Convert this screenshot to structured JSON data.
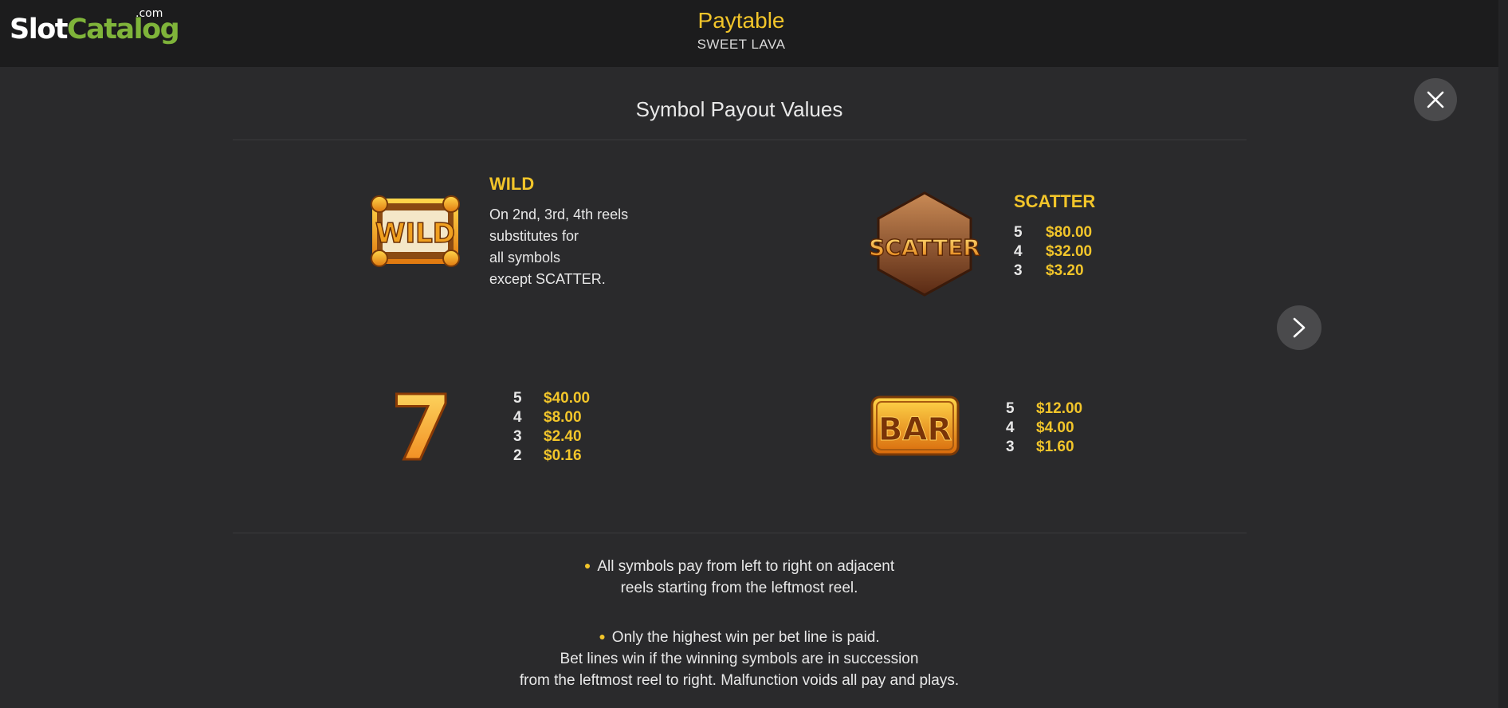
{
  "header": {
    "logo": {
      "slot": "Slot",
      "catalog": "Catalog",
      "dotcom": ".com"
    },
    "title": "Paytable",
    "subtitle": "SWEET LAVA"
  },
  "section_title": "Symbol Payout Values",
  "symbols": [
    {
      "name": "WILD",
      "icon_text": "WILD",
      "description": [
        "On 2nd, 3rd, 4th reels",
        "substitutes for",
        "all symbols",
        "except SCATTER."
      ]
    },
    {
      "name": "SCATTER",
      "icon_text": "SCATTER",
      "pays": [
        {
          "count": "5",
          "amount": "$80.00"
        },
        {
          "count": "4",
          "amount": "$32.00"
        },
        {
          "count": "3",
          "amount": "$3.20"
        }
      ]
    },
    {
      "name": "",
      "icon_text": "7",
      "pays": [
        {
          "count": "5",
          "amount": "$40.00"
        },
        {
          "count": "4",
          "amount": "$8.00"
        },
        {
          "count": "3",
          "amount": "$2.40"
        },
        {
          "count": "2",
          "amount": "$0.16"
        }
      ]
    },
    {
      "name": "",
      "icon_text": "BAR",
      "pays": [
        {
          "count": "5",
          "amount": "$12.00"
        },
        {
          "count": "4",
          "amount": "$4.00"
        },
        {
          "count": "3",
          "amount": "$1.60"
        }
      ]
    }
  ],
  "rules": [
    [
      "All symbols pay from left to right on adjacent",
      "reels starting from the leftmost reel."
    ],
    [
      "Only the highest win per bet line is paid.",
      "Bet lines win if the winning symbols are in succession",
      "from the leftmost reel to right. Malfunction voids all pay and plays."
    ]
  ],
  "icons": {
    "close": "close-icon",
    "next": "chevron-right-icon"
  },
  "colors": {
    "accent": "#f2c52a",
    "brand_green": "#7fb43a",
    "background": "#2a2a2c",
    "header_bg": "#1c1c1d"
  }
}
